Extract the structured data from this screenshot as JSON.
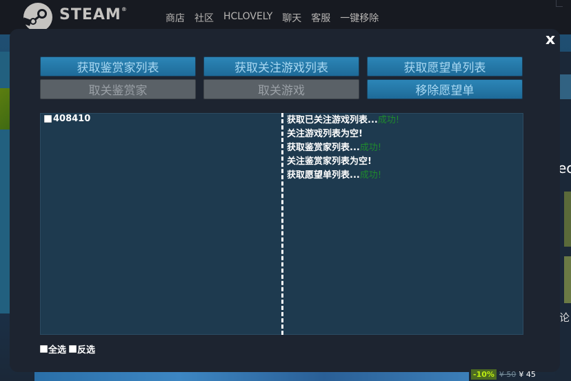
{
  "steam": {
    "logo_text": "STEAM",
    "trademark": "®",
    "nav": [
      "商店",
      "社区",
      "HCLOVELY",
      "聊天",
      "客服",
      "一键移除"
    ]
  },
  "background": {
    "right_text": "ec",
    "right_char": "论",
    "price": {
      "discount": "-10%",
      "old": "¥ 50",
      "new": "¥ 45"
    }
  },
  "modal": {
    "close_label": "x",
    "buttons_row1": [
      "获取鉴赏家列表",
      "获取关注游戏列表",
      "获取愿望单列表"
    ],
    "buttons_row2": [
      "取关鉴赏家",
      "取关游戏",
      "移除愿望单"
    ],
    "items": [
      {
        "id": "408410",
        "checked": false
      }
    ],
    "log": [
      {
        "text": "获取已关注游戏列表...",
        "status": "成功!"
      },
      {
        "text": "关注游戏列表为空!",
        "status": ""
      },
      {
        "text": "获取鉴赏家列表...",
        "status": "成功!"
      },
      {
        "text": "关注鉴赏家列表为空!",
        "status": ""
      },
      {
        "text": "获取愿望单列表...",
        "status": "成功!"
      }
    ],
    "select_all": "全选",
    "invert_select": "反选"
  },
  "colors": {
    "button_active": "#2c86b7",
    "button_disabled": "#5a6167",
    "success": "#1f8a2e",
    "panel": "#1e3a4f"
  }
}
